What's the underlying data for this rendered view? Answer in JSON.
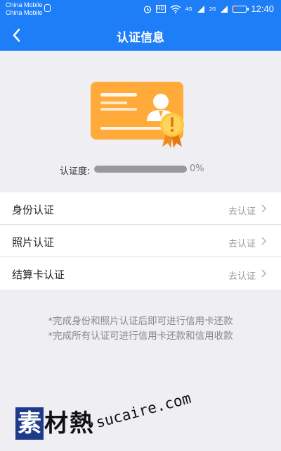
{
  "status_bar": {
    "carrier_line1": "China Mobile",
    "carrier_line2": "China Mobile",
    "hd_badge": "HD",
    "net_4g": "4G",
    "net_2g": "2G",
    "time": "12:40",
    "icons": [
      "alarm-icon",
      "wifi-icon",
      "signal-icon",
      "battery-icon"
    ],
    "battery_level": 0.1,
    "battery_color": "#ff3b30"
  },
  "navbar": {
    "title": "认证信息",
    "back_icon": "chevron-left-icon",
    "background": "#1e7ef8"
  },
  "certificate": {
    "icon": "id-card-certificate-icon",
    "card_color": "#ffa42e",
    "badge_color": "#ffc83d"
  },
  "progress": {
    "label": "认证度:",
    "value_text": "0%",
    "value": 0
  },
  "items": [
    {
      "label": "身份认证",
      "action": "去认证"
    },
    {
      "label": "照片认证",
      "action": "去认证"
    },
    {
      "label": "结算卡认证",
      "action": "去认证"
    }
  ],
  "notes": [
    "*完成身份和照片认证后即可进行信用卡还款",
    "*完成所有认证可进行信用卡还款和信用收款"
  ],
  "watermark": {
    "chars": [
      "素",
      "材",
      "熱"
    ],
    "url": "sucaire.com"
  }
}
